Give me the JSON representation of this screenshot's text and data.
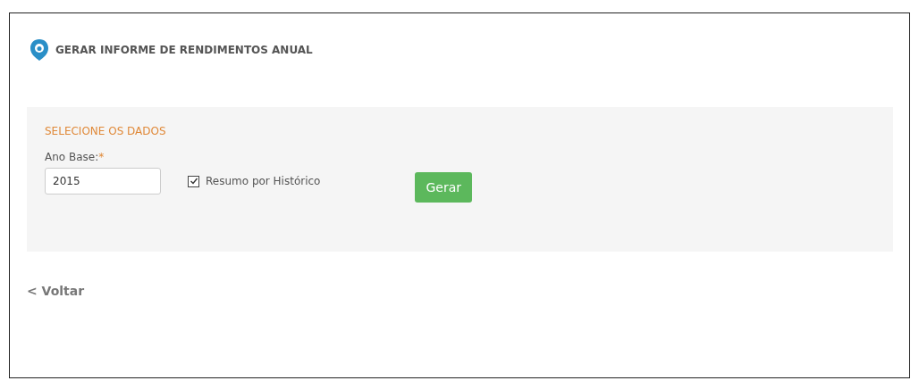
{
  "title": "GERAR INFORME DE RENDIMENTOS ANUAL",
  "panel": {
    "heading": "SELECIONE OS DADOS",
    "field": {
      "label": "Ano Base:",
      "required_mark": "*",
      "value": "2015"
    },
    "checkbox": {
      "label": "Resumo por Histórico",
      "checked": true
    },
    "button": "Gerar"
  },
  "back_link": "< Voltar"
}
